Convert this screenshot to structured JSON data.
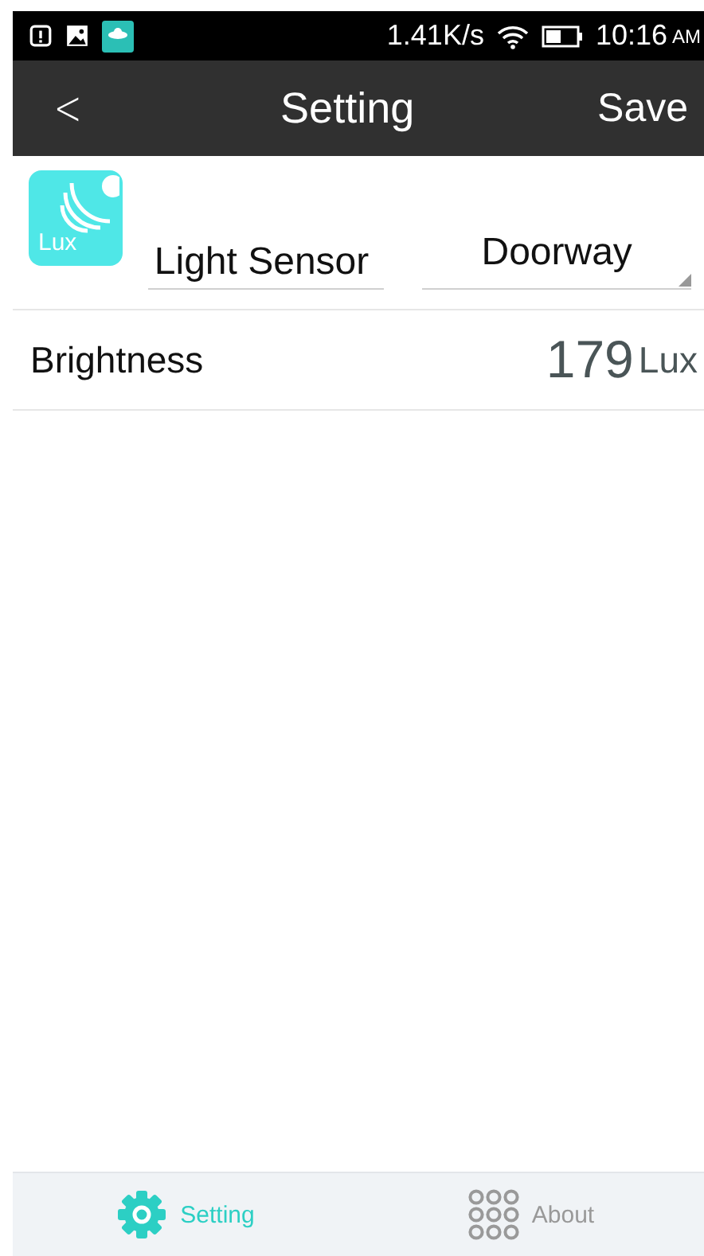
{
  "status_bar": {
    "speed": "1.41K/s",
    "time": "10:16",
    "ampm": "AM"
  },
  "header": {
    "back": "<",
    "title": "Setting",
    "action": "Save"
  },
  "sensor": {
    "icon_label": "Lux",
    "name": "Light Sensor",
    "location": "Doorway"
  },
  "readings": [
    {
      "label": "Brightness",
      "value": "179",
      "unit": "Lux"
    }
  ],
  "tabs": [
    {
      "label": "Setting",
      "kind": "gear",
      "selected": true
    },
    {
      "label": "About",
      "kind": "dots",
      "selected": false
    }
  ]
}
